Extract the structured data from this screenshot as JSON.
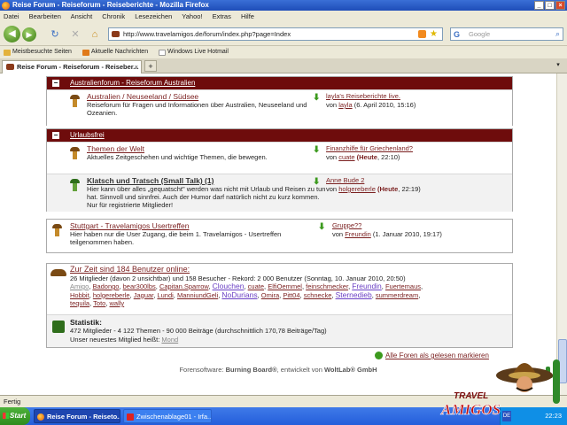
{
  "window": {
    "title": "Reise Forum - Reiseforum - Reiseberichte - Mozilla Firefox"
  },
  "menu": [
    "Datei",
    "Bearbeiten",
    "Ansicht",
    "Chronik",
    "Lesezeichen",
    "Yahoo!",
    "Extras",
    "Hilfe"
  ],
  "url": "http://www.travelamigos.de/forum/index.php?page=Index",
  "search_placeholder": "Google",
  "bookmarks": [
    "Meistbesuchte Seiten",
    "Aktuelle Nachrichten",
    "Windows Live Hotmail"
  ],
  "tab": {
    "title": "Reise Forum - Reiseforum - Reiseber...",
    "new": "+"
  },
  "cat1": {
    "title": "Australienforum - Reiseforum Australien",
    "forum": {
      "name": "Australien / Neuseeland / Südsee",
      "desc": "Reiseforum für Fragen und Informationen über Australien, Neuseeland und Ozeanien.",
      "last_title": "layla's Reiseberichte live.",
      "last_by": "von",
      "last_user": "layla",
      "last_date": "(6. April 2010, 15:16)"
    }
  },
  "cat2": {
    "title": "Urlaubsfrei",
    "forum1": {
      "name": "Themen der Welt",
      "desc": "Aktuelles Zeitgeschehen und wichtige Themen, die bewegen.",
      "last_title": "Finanzhilfe für Griechenland?",
      "last_by": "von",
      "last_user": "cuate",
      "last_date_bold": "(Heute",
      "last_time": ", 22:10)"
    },
    "forum2": {
      "name": "Klatsch und Tratsch (Small Talk) (1)",
      "desc": "Hier kann über alles „gequatscht\" werden was nicht mit Urlaub und Reisen zu tun hat. Sinnvoll und sinnfrei. Auch der Humor darf natürlich nicht zu kurz kommen. Nur für registrierte Mitglieder!",
      "last_title": "Anne Bude 2",
      "last_by": "von",
      "last_user": "holgereberle",
      "last_date_bold": "(Heute",
      "last_time": ", 22:19)"
    }
  },
  "cat3": {
    "forum": {
      "name": "Stuttgart - Travelamigos Usertreffen",
      "desc": "Hier haben nur die User Zugang, die beim 1. Travelamigos - Usertreffen teilgenommen haben.",
      "last_title": "Gruppe??",
      "last_by": "von",
      "last_user": "Freundin",
      "last_date": "(1. Januar 2010, 19:17)"
    }
  },
  "online": {
    "title": "Zur Zeit sind 184 Benutzer online:",
    "summary": "26 Mitglieder (davon 2 unsichtbar) und 158 Besucher - Rekord: 2 000 Benutzer (Sonntag, 10. Januar 2010, 20:50)",
    "users_line1": [
      "Amigo",
      "Badongo",
      "bear300lbs",
      "Capitan.Sparrow",
      "Clouchen",
      "cuate",
      "ElfiOemmel",
      "feinschmecker",
      "Freundin",
      "Fuertemaus"
    ],
    "users_line2": [
      "Hobbit",
      "holgereberle",
      "Jaguar",
      "Lundi",
      "ManniundGeli",
      "NoDurians",
      "Omira",
      "Pitt04",
      "schnecke",
      "Sternedieb",
      "summerdream"
    ],
    "users_line3": [
      "tequila",
      "Toto",
      "wally"
    ]
  },
  "stats": {
    "title": "Statistik:",
    "line1": "472 Mitglieder - 4 122 Themen - 90 000 Beiträge (durchschnittlich 170,78 Beiträge/Tag)",
    "line2": "Unser neuestes Mitglied heißt:",
    "newest": "Mond"
  },
  "mark_read": "Alle Foren als gelesen markieren",
  "footer": {
    "pre": "Forensoftware:",
    "product": "Burning Board®",
    "mid": ", entwickelt von",
    "company": "WoltLab® GmbH"
  },
  "status": "Fertig",
  "taskbar": {
    "start": "Start",
    "task1": "Reise Forum - Reiseto...",
    "task2": "Zwischenablage01 - Irfa...",
    "time": "22:23",
    "lang": "DE"
  },
  "logo": {
    "line1": "TRAVEL",
    "line2": "AMIGOS"
  },
  "colors": {
    "category_header": "#6e0c0c",
    "link": "#7a1f1f",
    "new_post_arrow": "#3c9a1e",
    "taskbar": "#245edb"
  }
}
